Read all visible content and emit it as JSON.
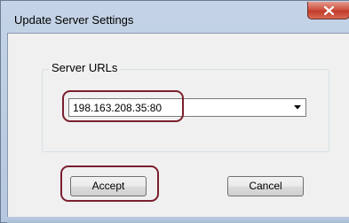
{
  "window": {
    "title": "Update Server Settings"
  },
  "group": {
    "label": "Server URLs"
  },
  "server_url": {
    "value": "198.163.208.35:80"
  },
  "buttons": {
    "accept": "Accept",
    "cancel": "Cancel"
  },
  "icons": {
    "close": "close-icon",
    "dropdown": "chevron-down-icon"
  },
  "colors": {
    "highlight": "#7a1f2e",
    "close_button": "#c03a29"
  }
}
